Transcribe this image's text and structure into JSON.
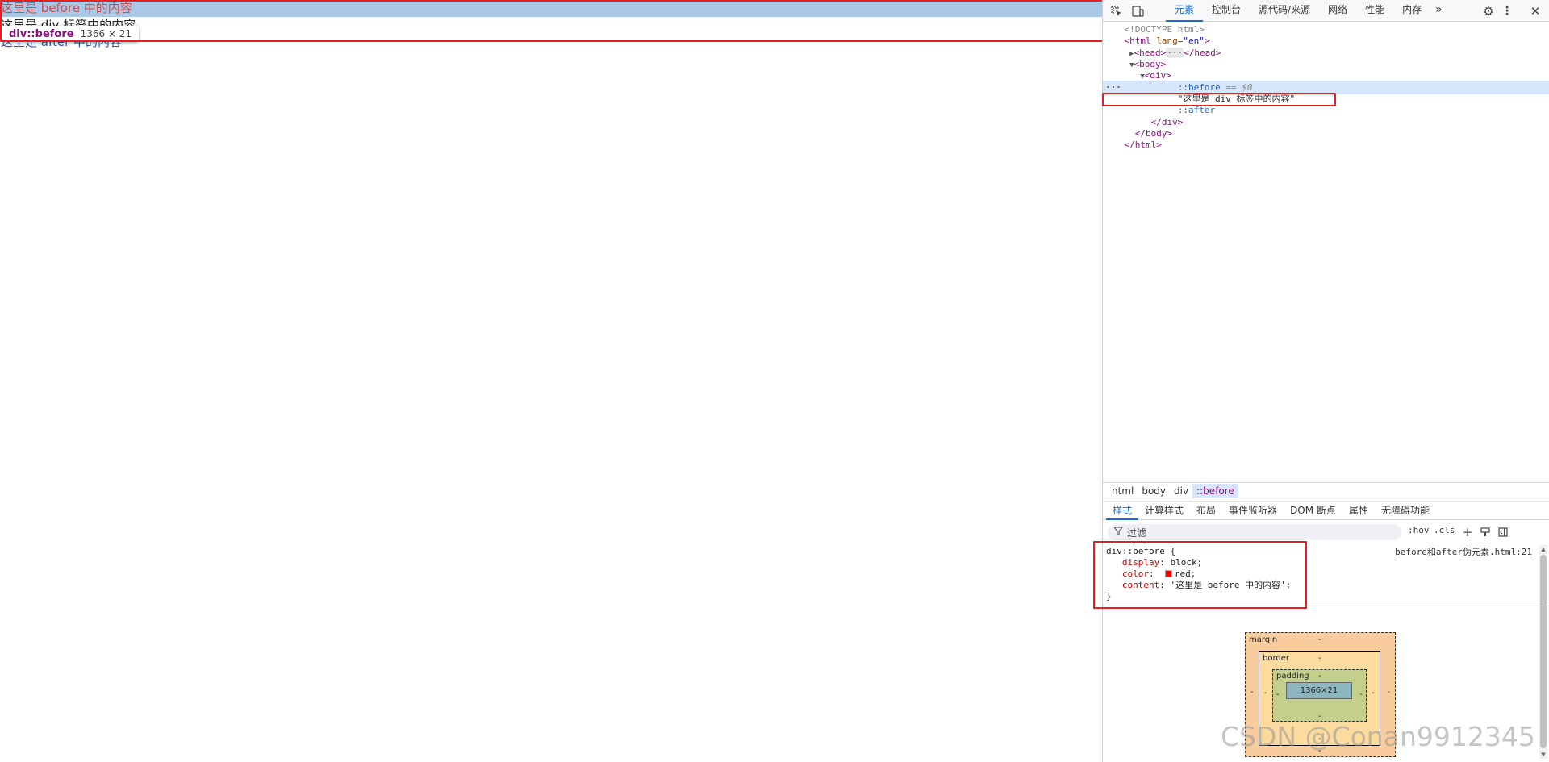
{
  "page": {
    "before_text": "这里是 before 中的内容",
    "div_text": "这里是 div 标签中的内容",
    "after_text": "这里是 after 中的内容",
    "tooltip_tag": "div::before",
    "tooltip_dims": "1366 × 21"
  },
  "devtools": {
    "tabs": [
      "元素",
      "控制台",
      "源代码/来源",
      "网络",
      "性能",
      "内存"
    ],
    "more_tabs": "»",
    "dom": {
      "doctype": "<!DOCTYPE html>",
      "html_open_tag": "<html",
      "html_attr_name": " lang",
      "html_attr_value": "\"en\"",
      "html_close_bracket": ">",
      "head_line": "<head>",
      "head_ellipsis": "···",
      "head_close": "</head>",
      "body_open": "<body>",
      "div_open": "<div>",
      "before_pseudo": "::before",
      "before_eq": " == $0",
      "div_text_node": "\"这里是 div 标签中的内容\"",
      "after_pseudo": "::after",
      "div_close": "</div>",
      "body_close": "</body>",
      "html_close": "</html>"
    },
    "breadcrumb": [
      "html",
      "body",
      "div",
      "::before"
    ],
    "subtabs": [
      "样式",
      "计算样式",
      "布局",
      "事件监听器",
      "DOM 断点",
      "属性",
      "无障碍功能"
    ],
    "filter_placeholder": "过滤",
    "hov_label": ":hov",
    "cls_label": ".cls",
    "styles": {
      "selector_line": "div::before {",
      "prop1_name": "display",
      "prop1_value": "block;",
      "prop2_name": "color",
      "prop2_value": "red;",
      "prop3_name": "content",
      "prop3_value": "'这里是 before 中的内容';",
      "close_brace": "}",
      "source": "before和after伪元素.html:21"
    },
    "box_model": {
      "margin_label": "margin",
      "border_label": "border",
      "padding_label": "padding",
      "content_size": "1366×21",
      "dash": "-"
    }
  },
  "watermark": "CSDN @Conan9912345",
  "colors": {
    "highlight_bar": "#a9c7e6",
    "annotation_red": "#e81e1e",
    "accent_blue": "#1a6dd6",
    "tag_purple": "#881280"
  }
}
